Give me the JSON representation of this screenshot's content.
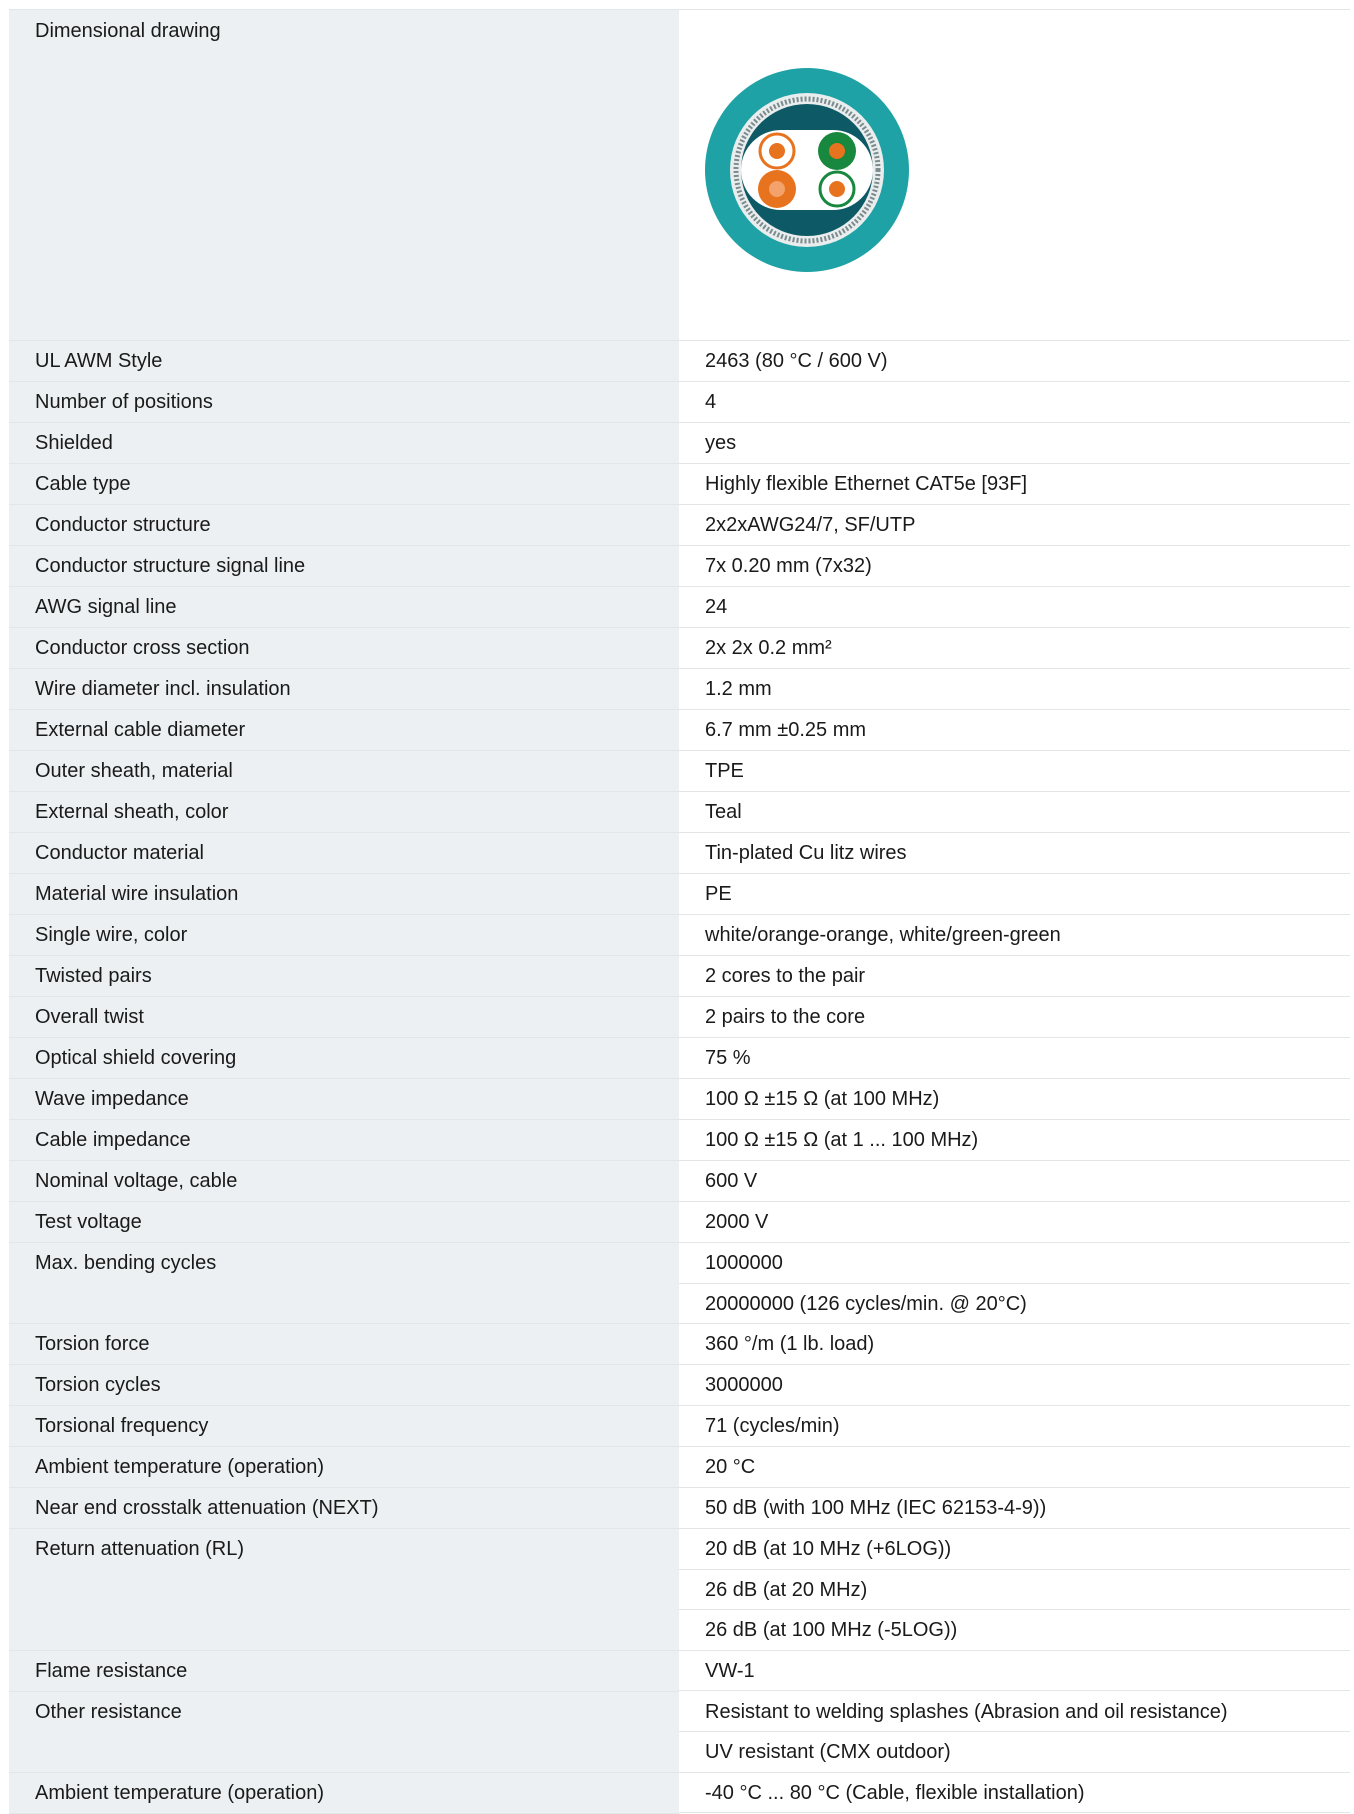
{
  "drawing": {
    "label": "Dimensional drawing",
    "image": "cable-cross-section-icon",
    "colors": {
      "outer_sheath": "#1fa2a5",
      "shield": "#d8dcdc",
      "inner": "#0d5a66",
      "orange": "#e8731e",
      "green": "#17883e",
      "white": "#ffffff"
    }
  },
  "rows": [
    {
      "label": "UL AWM Style",
      "values": [
        "2463 (80 °C / 600 V)"
      ]
    },
    {
      "label": "Number of positions",
      "values": [
        "4"
      ]
    },
    {
      "label": "Shielded",
      "values": [
        "yes"
      ]
    },
    {
      "label": "Cable type",
      "values": [
        "Highly flexible Ethernet CAT5e [93F]"
      ]
    },
    {
      "label": "Conductor structure",
      "values": [
        "2x2xAWG24/7, SF/UTP"
      ]
    },
    {
      "label": "Conductor structure signal line",
      "values": [
        "7x 0.20 mm (7x32)"
      ]
    },
    {
      "label": "AWG signal line",
      "values": [
        "24"
      ]
    },
    {
      "label": "Conductor cross section",
      "values": [
        "2x 2x 0.2 mm²"
      ]
    },
    {
      "label": "Wire diameter incl. insulation",
      "values": [
        "1.2 mm"
      ]
    },
    {
      "label": "External cable diameter",
      "values": [
        "6.7 mm ±0.25 mm"
      ]
    },
    {
      "label": "Outer sheath, material",
      "values": [
        "TPE"
      ]
    },
    {
      "label": "External sheath, color",
      "values": [
        "Teal"
      ]
    },
    {
      "label": "Conductor material",
      "values": [
        "Tin-plated Cu litz wires"
      ]
    },
    {
      "label": "Material wire insulation",
      "values": [
        "PE"
      ]
    },
    {
      "label": "Single wire, color",
      "values": [
        "white/orange-orange, white/green-green"
      ]
    },
    {
      "label": "Twisted pairs",
      "values": [
        "2 cores to the pair"
      ]
    },
    {
      "label": "Overall twist",
      "values": [
        "2 pairs to the core"
      ]
    },
    {
      "label": "Optical shield covering",
      "values": [
        "75 %"
      ]
    },
    {
      "label": "Wave impedance",
      "values": [
        "100 Ω ±15 Ω (at 100 MHz)"
      ]
    },
    {
      "label": "Cable impedance",
      "values": [
        "100 Ω ±15 Ω (at 1 ... 100 MHz)"
      ]
    },
    {
      "label": "Nominal voltage, cable",
      "values": [
        "600 V"
      ]
    },
    {
      "label": "Test voltage",
      "values": [
        "2000 V"
      ]
    },
    {
      "label": "Max. bending cycles",
      "values": [
        "1000000",
        "20000000 (126 cycles/min. @ 20°C)"
      ]
    },
    {
      "label": "Torsion force",
      "values": [
        "360 °/m (1 lb. load)"
      ]
    },
    {
      "label": "Torsion cycles",
      "values": [
        "3000000"
      ]
    },
    {
      "label": "Torsional frequency",
      "values": [
        "71 (cycles/min)"
      ]
    },
    {
      "label": "Ambient temperature (operation)",
      "values": [
        "20 °C"
      ]
    },
    {
      "label": "Near end crosstalk attenuation (NEXT)",
      "values": [
        "50 dB (with 100 MHz (IEC 62153-4-9))"
      ]
    },
    {
      "label": "Return attenuation (RL)",
      "values": [
        "20 dB (at 10 MHz (+6LOG))",
        "26 dB (at 20 MHz)",
        "26 dB (at 100 MHz (-5LOG))"
      ]
    },
    {
      "label": "Flame resistance",
      "values": [
        "VW-1"
      ]
    },
    {
      "label": "Other resistance",
      "values": [
        "Resistant to welding splashes (Abrasion and oil resistance)",
        "UV resistant (CMX outdoor)"
      ]
    },
    {
      "label": "Ambient temperature (operation)",
      "values": [
        "-40 °C ... 80 °C (Cable, flexible installation)"
      ]
    }
  ]
}
